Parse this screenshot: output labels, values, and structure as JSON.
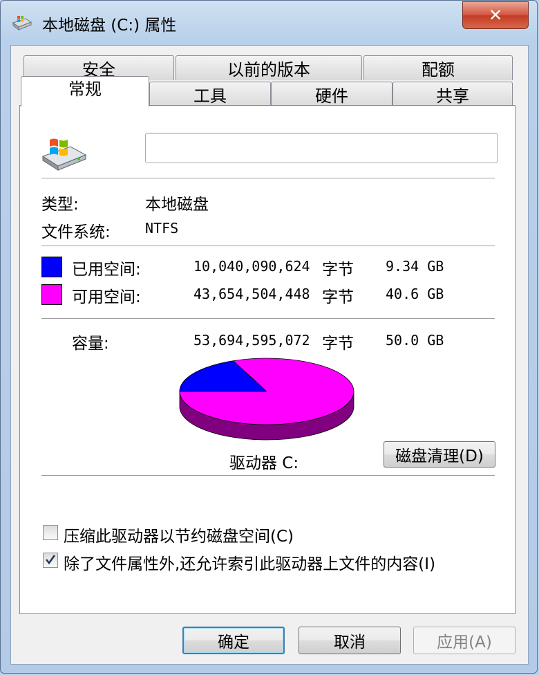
{
  "window": {
    "title": "本地磁盘 (C:) 属性",
    "close_label": "✕"
  },
  "tabs_back": [
    "安全",
    "以前的版本",
    "配额"
  ],
  "tabs_front": [
    "常规",
    "工具",
    "硬件",
    "共享"
  ],
  "active_tab": "常规",
  "general": {
    "name_value": "",
    "type_label": "类型:",
    "type_value": "本地磁盘",
    "fs_label": "文件系统:",
    "fs_value": "NTFS",
    "used": {
      "label": "已用空间:",
      "bytes": "10,040,090,624",
      "unit": "字节",
      "size": "9.34 GB",
      "color": "#0000ff"
    },
    "free": {
      "label": "可用空间:",
      "bytes": "43,654,504,448",
      "unit": "字节",
      "size": "40.6 GB",
      "color": "#ff00ff"
    },
    "capacity": {
      "label": "容量:",
      "bytes": "53,694,595,072",
      "unit": "字节",
      "size": "50.0 GB"
    },
    "used_fraction": 0.187,
    "drive_label": "驱动器 C:",
    "cleanup_button": "磁盘清理(D)",
    "compress_label": "压缩此驱动器以节约磁盘空间(C)",
    "compress_checked": false,
    "index_label": "除了文件属性外,还允许索引此驱动器上文件的内容(I)",
    "index_checked": true
  },
  "footer": {
    "ok": "确定",
    "cancel": "取消",
    "apply": "应用(A)"
  },
  "icons": {
    "title": "drive-icon",
    "drive": "windows-drive-icon"
  }
}
